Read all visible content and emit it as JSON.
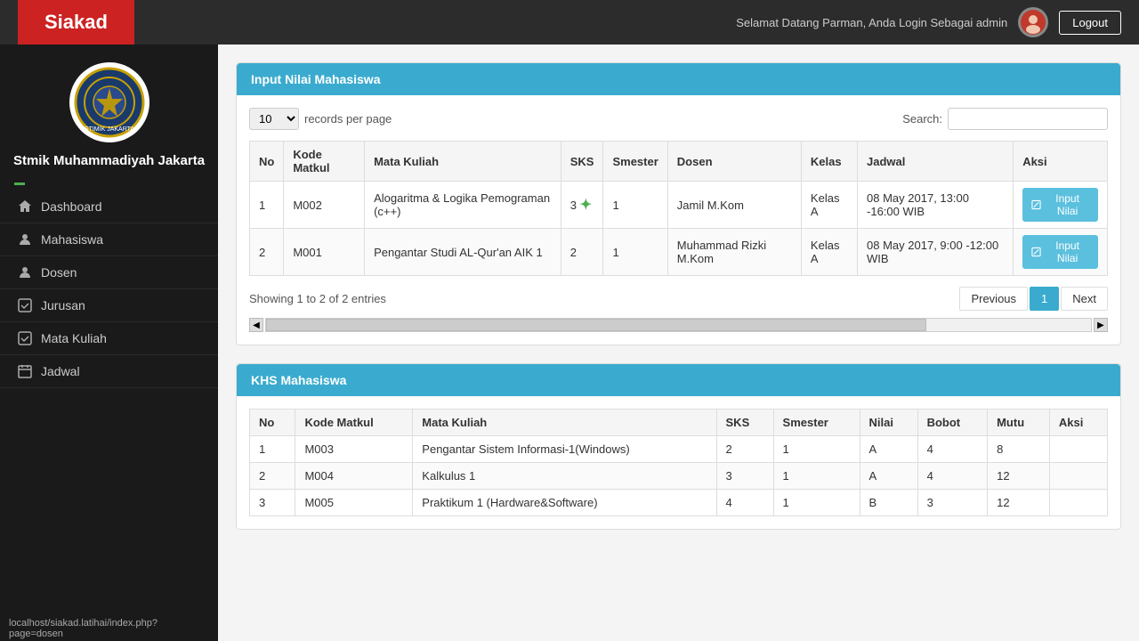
{
  "app": {
    "title": "Siakad"
  },
  "header": {
    "greeting": "Selamat Datang Parman,   Anda Login Sebagai admin",
    "logout_label": "Logout"
  },
  "sidebar": {
    "school_name": "Stmik Muhammadiyah Jakarta",
    "items": [
      {
        "label": "Dashboard",
        "icon": "home-icon"
      },
      {
        "label": "Mahasiswa",
        "icon": "user-icon"
      },
      {
        "label": "Dosen",
        "icon": "user-icon"
      },
      {
        "label": "Jurusan",
        "icon": "check-icon"
      },
      {
        "label": "Mata Kuliah",
        "icon": "check-icon"
      },
      {
        "label": "Jadwal",
        "icon": "calendar-icon"
      }
    ],
    "status_bar_text": "localhost/siakad.latihai/index.php?page=dosen"
  },
  "panel_nilai": {
    "title": "Input Nilai Mahasiswa",
    "records_label": "records per page",
    "records_value": "10",
    "search_label": "Search:",
    "search_value": "",
    "table": {
      "headers": [
        "No",
        "Kode Matkul",
        "Mata Kuliah",
        "SKS",
        "Smester",
        "Dosen",
        "Kelas",
        "Jadwal",
        "Aksi"
      ],
      "rows": [
        {
          "no": "1",
          "kode": "M002",
          "matkul": "Alogaritma & Logika Pemograman (c++)",
          "sks": "3",
          "smester": "1",
          "dosen": "Jamil M.Kom",
          "kelas": "Kelas A",
          "jadwal": "08 May 2017,  13:00 -16:00  WIB",
          "aksi": "Input Nilai"
        },
        {
          "no": "2",
          "kode": "M001",
          "matkul": "Pengantar Studi AL-Qur'an AIK 1",
          "sks": "2",
          "smester": "1",
          "dosen": "Muhammad Rizki M.Kom",
          "kelas": "Kelas A",
          "jadwal": "08 May 2017,  9:00 -12:00  WIB",
          "aksi": "Input Nilai"
        }
      ]
    },
    "showing_text": "Showing 1 to 2 of 2 entries",
    "pagination": {
      "previous": "Previous",
      "next": "Next",
      "current_page": "1"
    }
  },
  "panel_khs": {
    "title": "KHS Mahasiswa",
    "table": {
      "headers": [
        "No",
        "Kode Matkul",
        "Mata Kuliah",
        "SKS",
        "Smester",
        "Nilai",
        "Bobot",
        "Mutu",
        "Aksi"
      ],
      "rows": [
        {
          "no": "1",
          "kode": "M003",
          "matkul": "Pengantar Sistem Informasi-1(Windows)",
          "sks": "2",
          "smester": "1",
          "nilai": "A",
          "bobot": "4",
          "mutu": "8",
          "aksi": ""
        },
        {
          "no": "2",
          "kode": "M004",
          "matkul": "Kalkulus 1",
          "sks": "3",
          "smester": "1",
          "nilai": "A",
          "bobot": "4",
          "mutu": "12",
          "aksi": ""
        },
        {
          "no": "3",
          "kode": "M005",
          "matkul": "Praktikum 1 (Hardware&Software)",
          "sks": "4",
          "smester": "1",
          "nilai": "B",
          "bobot": "3",
          "mutu": "12",
          "aksi": ""
        }
      ]
    }
  }
}
